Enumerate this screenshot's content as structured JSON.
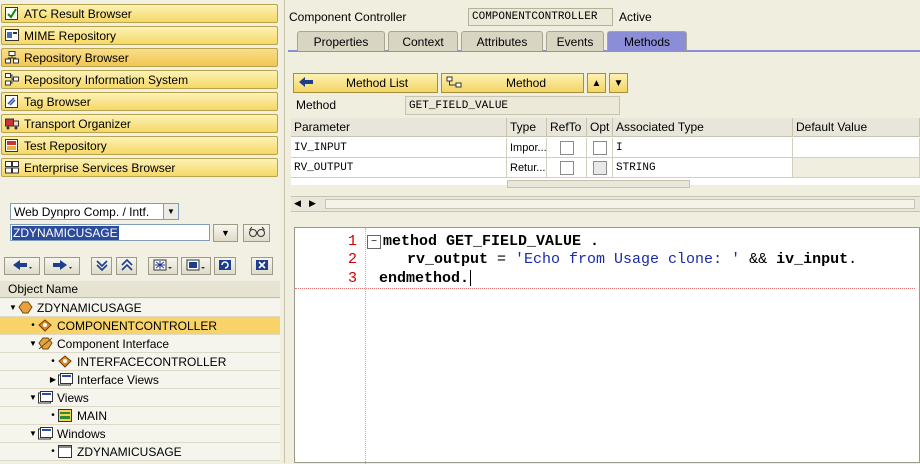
{
  "nav": {
    "buttons": [
      {
        "label": "ATC Result Browser",
        "icon": "atc-check-icon"
      },
      {
        "label": "MIME Repository",
        "icon": "mime-icon"
      },
      {
        "label": "Repository Browser",
        "icon": "repository-icon"
      },
      {
        "label": "Repository Information System",
        "icon": "info-system-icon"
      },
      {
        "label": "Tag Browser",
        "icon": "tag-icon"
      },
      {
        "label": "Transport Organizer",
        "icon": "truck-icon"
      },
      {
        "label": "Test Repository",
        "icon": "test-icon"
      },
      {
        "label": "Enterprise Services Browser",
        "icon": "services-icon"
      }
    ]
  },
  "object_selector": {
    "type_value": "Web Dynpro Comp. / Intf.",
    "name_value": "ZDYNAMICUSAGE"
  },
  "tree": {
    "header": "Object Name",
    "rows": [
      {
        "label": "ZDYNAMICUSAGE"
      },
      {
        "label": "COMPONENTCONTROLLER"
      },
      {
        "label": "Component Interface"
      },
      {
        "label": "INTERFACECONTROLLER"
      },
      {
        "label": "Interface Views"
      },
      {
        "label": "Views"
      },
      {
        "label": "MAIN"
      },
      {
        "label": "Windows"
      },
      {
        "label": "ZDYNAMICUSAGE"
      }
    ]
  },
  "header": {
    "label": "Component Controller",
    "name": "COMPONENTCONTROLLER",
    "status": "Active"
  },
  "tabs": [
    "Properties",
    "Context",
    "Attributes",
    "Events",
    "Methods"
  ],
  "method_toolbar": {
    "method_list_label": "Method List",
    "method_label": "Method"
  },
  "method": {
    "label": "Method",
    "value": "GET_FIELD_VALUE"
  },
  "param_table": {
    "columns": [
      "Parameter",
      "Type",
      "RefTo",
      "Opt",
      "Associated Type",
      "Default Value"
    ],
    "rows": [
      {
        "parameter": "IV_INPUT",
        "type": "Impor...",
        "assoc": "I",
        "default": ""
      },
      {
        "parameter": "RV_OUTPUT",
        "type": "Retur...",
        "assoc": "STRING",
        "default": ""
      }
    ]
  },
  "code": {
    "line_numbers": [
      "1",
      "2",
      "3"
    ],
    "line1_kw": "method GET_FIELD_VALUE .",
    "line2_var": "rv_output",
    "line2_eq": " = ",
    "line2_str": "'Echo from Usage clone: '",
    "line2_op": " && ",
    "line2_var2": "iv_input",
    "line2_end": ".",
    "line3_kw": "endmethod."
  }
}
